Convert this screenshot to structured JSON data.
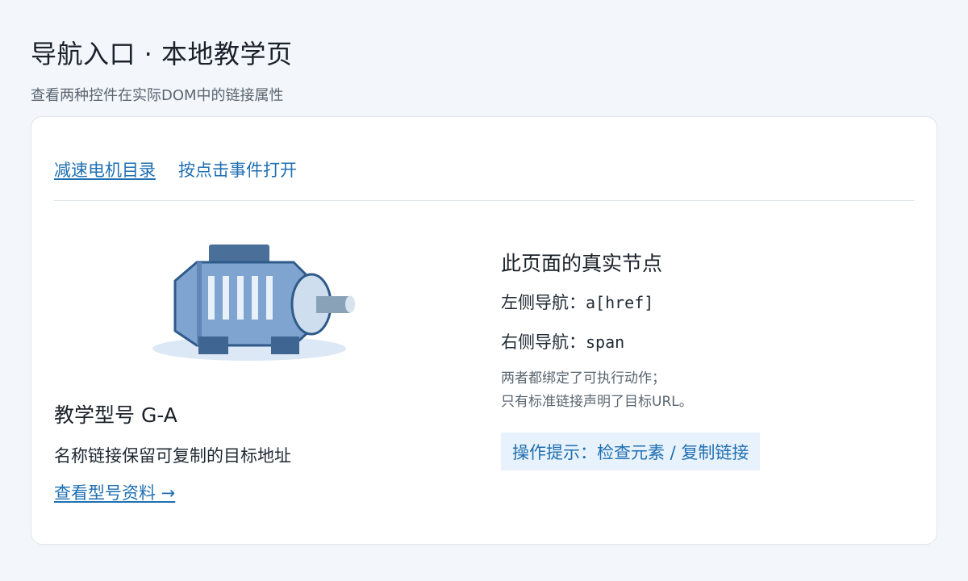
{
  "header": {
    "title": "导航入口 · 本地教学页",
    "subtitle": "查看两种控件在实际DOM中的链接属性"
  },
  "nav": {
    "link_label": "减速电机目录",
    "span_label": "按点击事件打开"
  },
  "product": {
    "image_icon": "motor-illustration",
    "title": "教学型号 G-A",
    "description": "名称链接保留可复制的目标地址",
    "link_label": "查看型号资料 →"
  },
  "info": {
    "title": "此页面的真实节点",
    "left_label": "左侧导航：",
    "left_value": "a[href]",
    "right_label": "右侧导航：",
    "right_value": "span",
    "note_line1": "两者都绑定了可执行动作；",
    "note_line2": "只有标准链接声明了目标URL。",
    "hint": "操作提示：检查元素 / 复制链接"
  },
  "colors": {
    "accent": "#1f6fb2",
    "background": "#f3f6fb",
    "hint_bg": "#e8f2fc"
  }
}
